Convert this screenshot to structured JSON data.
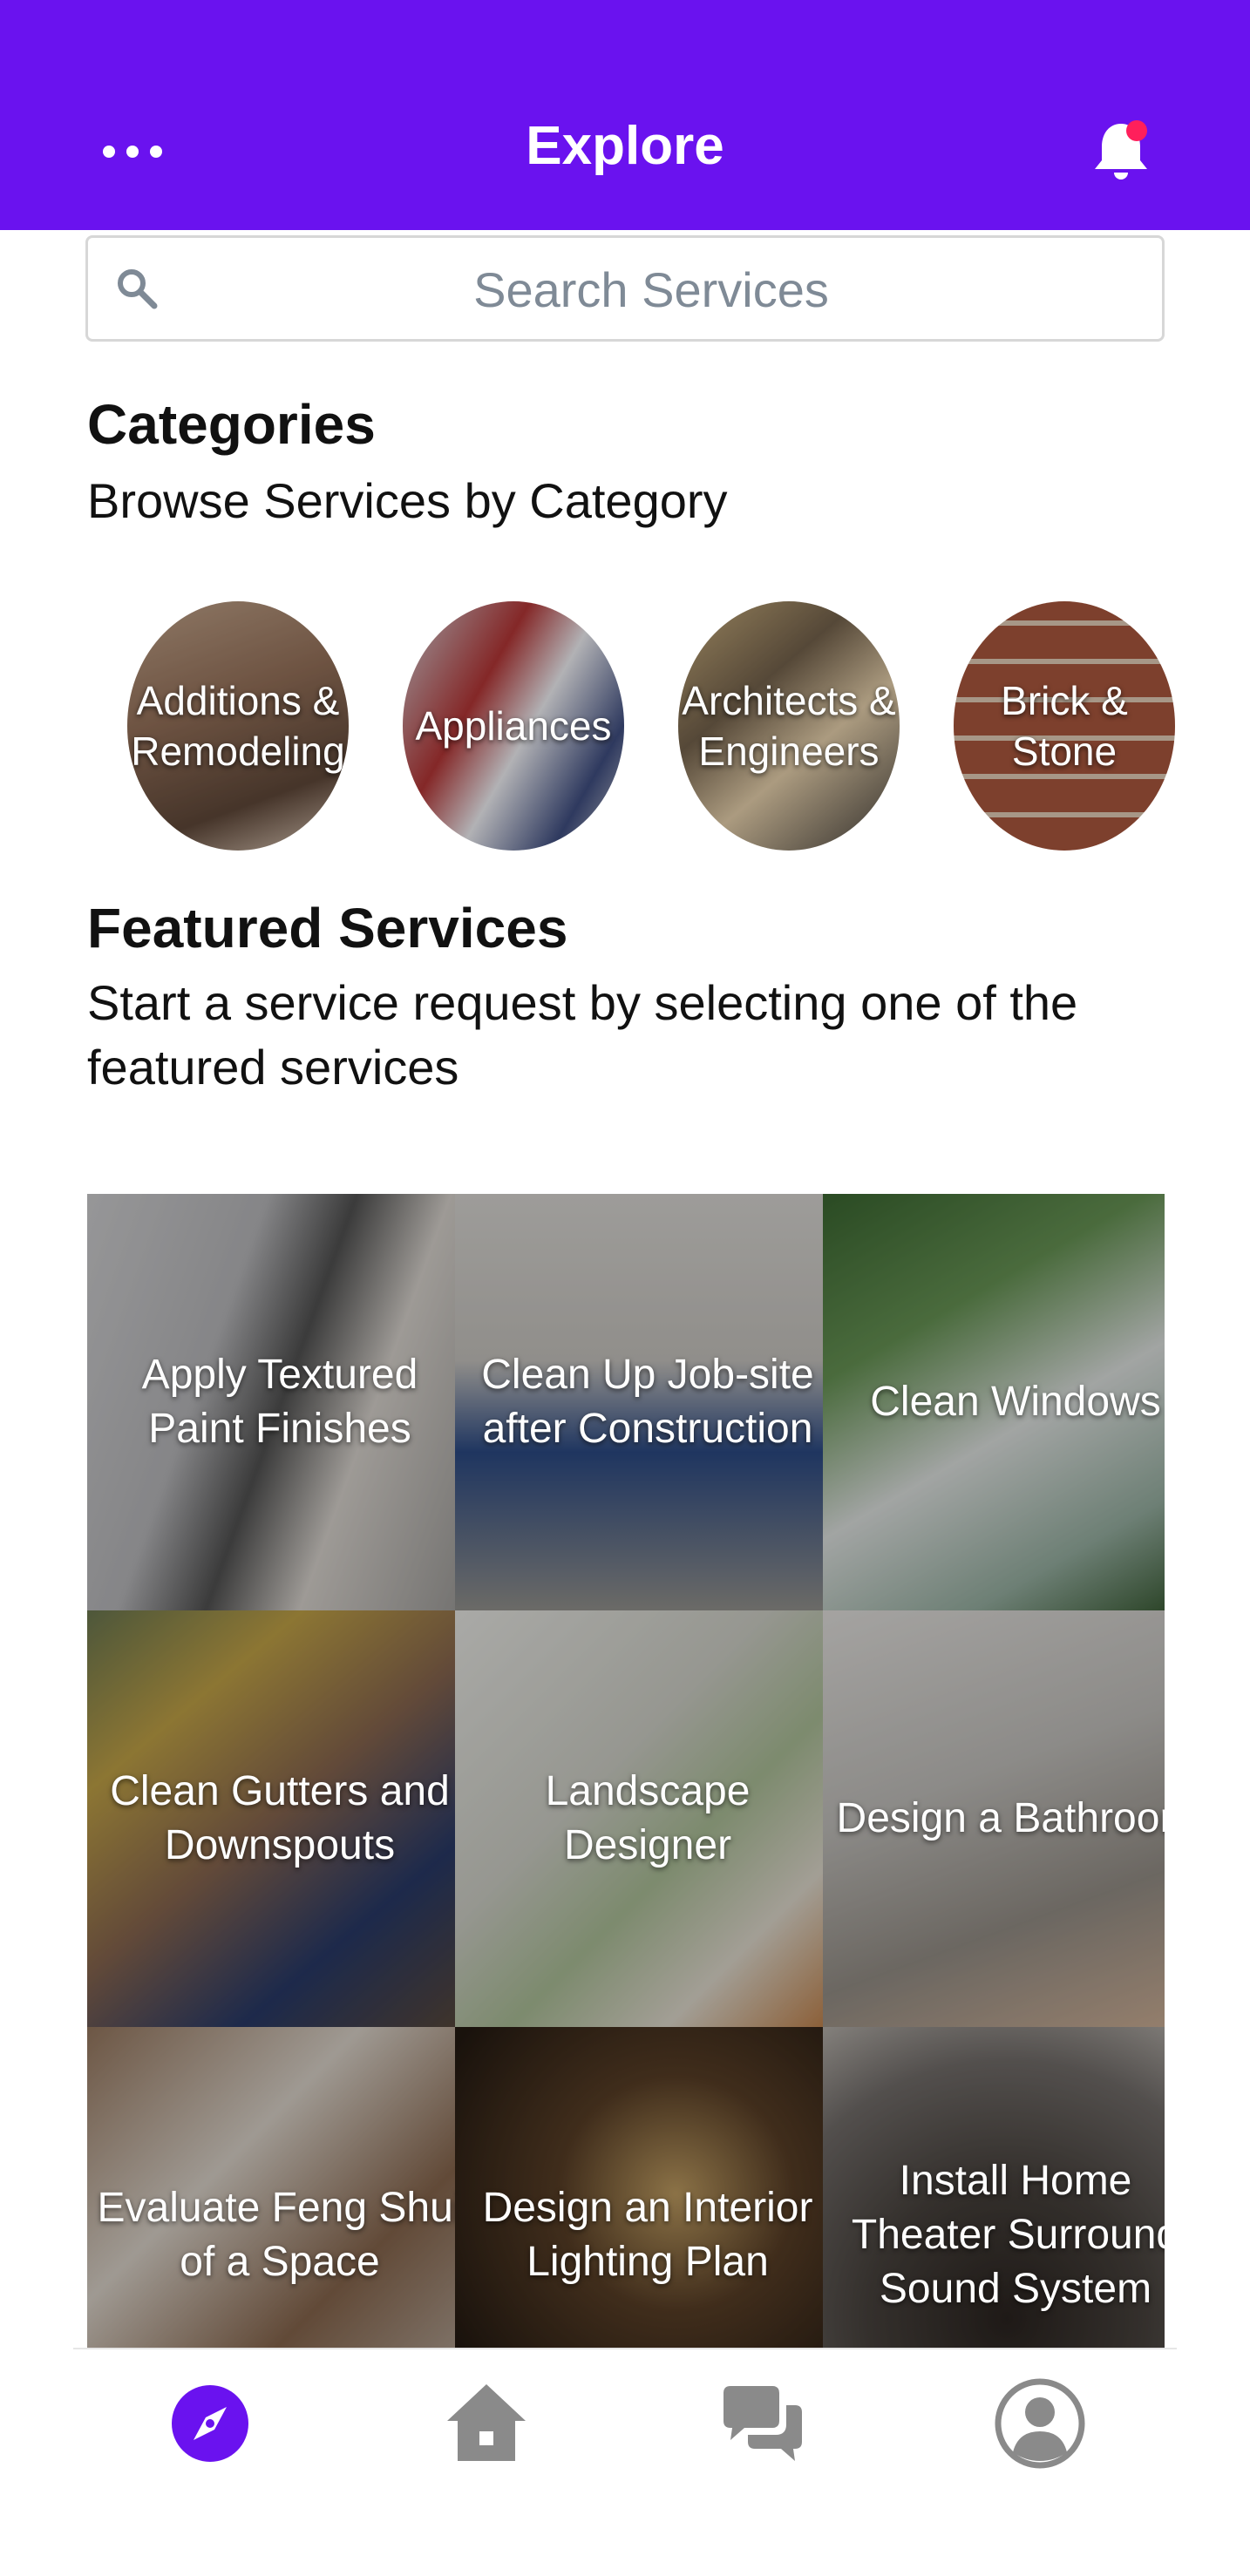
{
  "header": {
    "title": "Explore",
    "menu_icon": "more-horizontal-icon",
    "bell_icon": "bell-icon",
    "bell_badge_color": "#ff1f5b",
    "background_color": "#6a12ef"
  },
  "search": {
    "placeholder": "Search Services",
    "icon": "search-icon"
  },
  "categories": {
    "title": "Categories",
    "subtitle": "Browse Services by Category",
    "items": [
      {
        "label": "Additions &\nRemodeling"
      },
      {
        "label": "Appliances"
      },
      {
        "label": "Architects &\nEngineers"
      },
      {
        "label": "Brick &\nStone"
      }
    ]
  },
  "featured": {
    "title": "Featured Services",
    "subtitle": "Start a service request by selecting one of the featured services",
    "tiles": [
      {
        "label": "Apply Textured\nPaint Finishes"
      },
      {
        "label": "Clean Up Job-site\nafter Construction"
      },
      {
        "label": "Clean Windows"
      },
      {
        "label": "Clean Gutters and\nDownspouts"
      },
      {
        "label": "Landscape\nDesigner"
      },
      {
        "label": "Design a Bathroom"
      },
      {
        "label": "Evaluate Feng Shui\nof a Space"
      },
      {
        "label": "Design an Interior\nLighting Plan"
      },
      {
        "label": "Install Home\nTheater Surround\nSound System"
      }
    ]
  },
  "bottom_nav": {
    "items": [
      {
        "icon": "compass-icon",
        "active": true
      },
      {
        "icon": "home-icon",
        "active": false
      },
      {
        "icon": "chat-icon",
        "active": false
      },
      {
        "icon": "profile-icon",
        "active": false
      }
    ],
    "active_color": "#6a12ef",
    "inactive_color": "#8a8a8a"
  }
}
